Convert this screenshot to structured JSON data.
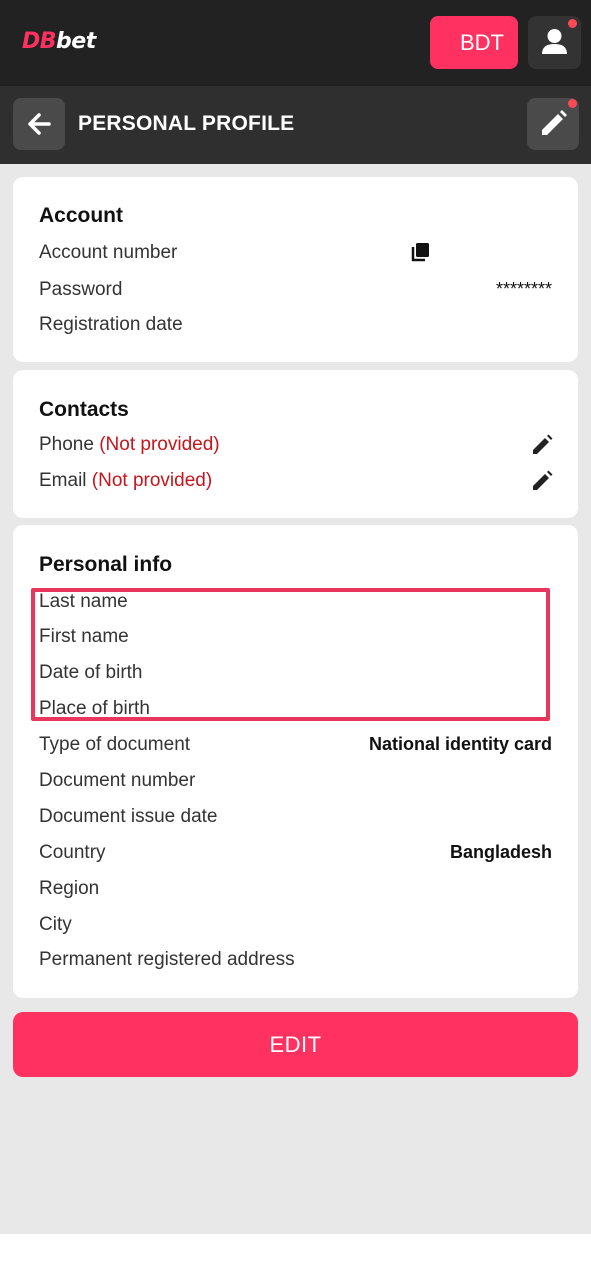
{
  "topbar": {
    "logo_db": "DB",
    "logo_bet": "bet",
    "currency": "BDT",
    "brand_color": "#ff3160",
    "user_icon": "user-icon",
    "notification_dot_color": "#ff4a55"
  },
  "header": {
    "title": "PERSONAL PROFILE",
    "back_icon": "arrow-left-icon",
    "edit_icon": "pencil-icon"
  },
  "account": {
    "title": "Account",
    "rows": [
      {
        "label": "Account number",
        "value": "",
        "icon": "copy-icon"
      },
      {
        "label": "Password",
        "value": "********"
      },
      {
        "label": "Registration date",
        "value": ""
      }
    ]
  },
  "contacts": {
    "title": "Contacts",
    "rows": [
      {
        "label": "Phone",
        "status": "(Not provided)",
        "icon": "pencil-icon"
      },
      {
        "label": "Email",
        "status": "(Not provided)",
        "icon": "pencil-icon"
      }
    ]
  },
  "personal_info": {
    "title": "Personal info",
    "rows": [
      {
        "label": "Last name",
        "value": ""
      },
      {
        "label": "First name",
        "value": ""
      },
      {
        "label": "Date of birth",
        "value": ""
      },
      {
        "label": "Place of birth",
        "value": ""
      },
      {
        "label": "Type of document",
        "value": "National identity card"
      },
      {
        "label": "Document number",
        "value": ""
      },
      {
        "label": "Document issue date",
        "value": ""
      },
      {
        "label": "Country",
        "value": "Bangladesh"
      },
      {
        "label": "Region",
        "value": ""
      },
      {
        "label": "City",
        "value": ""
      },
      {
        "label": "Permanent registered address",
        "value": ""
      }
    ]
  },
  "edit_button": "EDIT"
}
